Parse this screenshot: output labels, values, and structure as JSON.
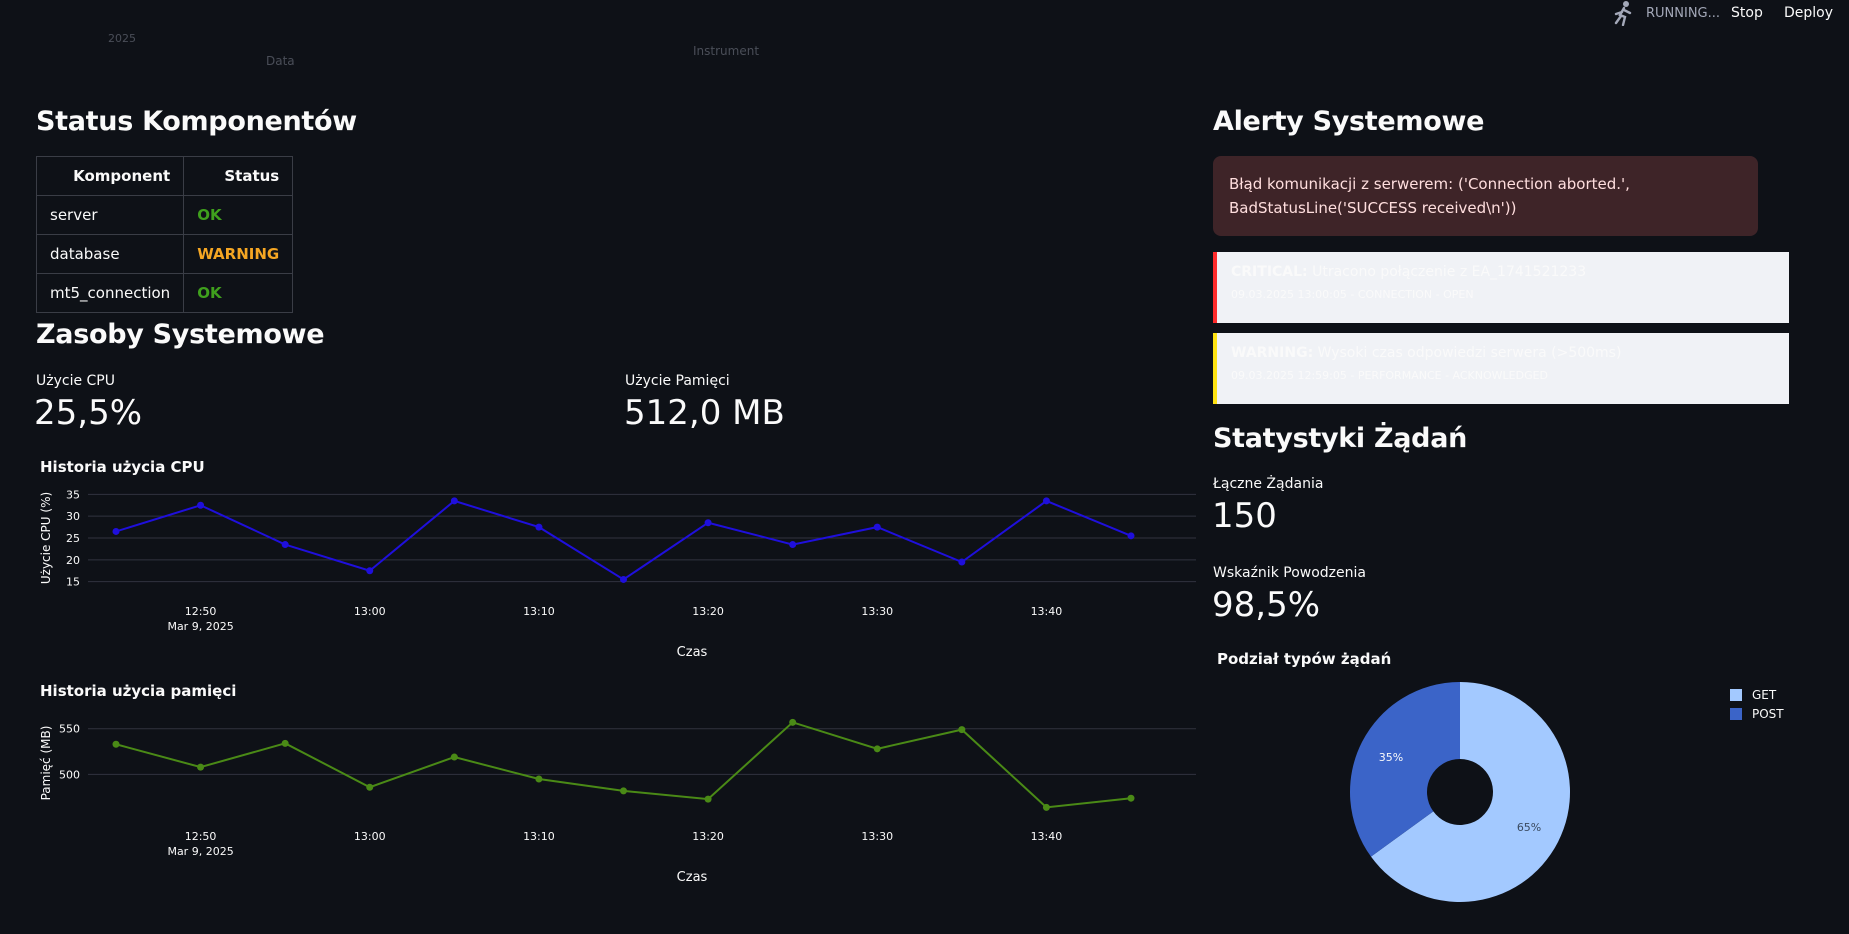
{
  "topbar": {
    "status": "RUNNING...",
    "stop_label": "Stop",
    "deploy_label": "Deploy"
  },
  "ghost": {
    "year": "2025",
    "data": "Data",
    "instrument": "Instrument"
  },
  "components": {
    "title": "Status Komponentów",
    "headers": [
      "Komponent",
      "Status"
    ],
    "rows": [
      {
        "name": "server",
        "status": "OK",
        "color": "#3fa01d"
      },
      {
        "name": "database",
        "status": "WARNING",
        "color": "#f5a623"
      },
      {
        "name": "mt5_connection",
        "status": "OK",
        "color": "#3fa01d"
      }
    ]
  },
  "resources": {
    "title": "Zasoby Systemowe",
    "cpu_label": "Użycie CPU",
    "cpu_value": "25,5%",
    "mem_label": "Użycie Pamięci",
    "mem_value": "512,0 MB"
  },
  "alerts": {
    "title": "Alerty Systemowe",
    "error": "Błąd komunikacji z serwerem: ('Connection aborted.', BadStatusLine('SUCCESS received\\n'))",
    "items": [
      {
        "level": "CRITICAL:",
        "message": "Utracono połączenie z EA_1741521233",
        "meta": "09.03.2025 13:00:05 - CONNECTION - OPEN",
        "color": "#ff2b2b"
      },
      {
        "level": "WARNING:",
        "message": "Wysoki czas odpowiedzi serwera (>500ms)",
        "meta": "09.03.2025 12:59:05 - PERFORMANCE - ACKNOWLEDGED",
        "color": "#ffe312"
      }
    ]
  },
  "requests": {
    "title": "Statystyki Żądań",
    "total_label": "Łączne Żądania",
    "total_value": "150",
    "success_label": "Wskaźnik Powodzenia",
    "success_value": "98,5%"
  },
  "chart_data": [
    {
      "type": "line",
      "title": "Historia użycia CPU",
      "xlabel": "Czas",
      "ylabel": "Użycie CPU (%)",
      "x": [
        "12:45",
        "12:50",
        "12:55",
        "13:00",
        "13:05",
        "13:10",
        "13:15",
        "13:20",
        "13:25",
        "13:30",
        "13:35",
        "13:40",
        "13:45"
      ],
      "xticks": [
        "12:50",
        "13:00",
        "13:10",
        "13:20",
        "13:30",
        "13:40"
      ],
      "xtick_sub": "Mar 9, 2025",
      "ylim": [
        14,
        36
      ],
      "yticks": [
        15,
        20,
        25,
        30,
        35
      ],
      "series": [
        {
          "values": [
            26.5,
            32.5,
            23.5,
            17.5,
            33.5,
            27.5,
            15.5,
            28.5,
            23.5,
            27.5,
            19.5,
            33.5,
            25.5
          ],
          "color": "#1f0fdc"
        }
      ]
    },
    {
      "type": "line",
      "title": "Historia użycia pamięci",
      "xlabel": "Czas",
      "ylabel": "Pamięć (MB)",
      "x": [
        "12:45",
        "12:50",
        "12:55",
        "13:00",
        "13:05",
        "13:10",
        "13:15",
        "13:20",
        "13:25",
        "13:30",
        "13:35",
        "13:40",
        "13:45"
      ],
      "xticks": [
        "12:50",
        "13:00",
        "13:10",
        "13:20",
        "13:30",
        "13:40"
      ],
      "xtick_sub": "Mar 9, 2025",
      "ylim": [
        460,
        565
      ],
      "yticks": [
        500,
        550
      ],
      "series": [
        {
          "values": [
            533,
            508,
            534,
            486,
            519,
            495,
            482,
            473,
            557,
            528,
            549,
            464,
            474
          ],
          "color": "#4a8a16"
        }
      ]
    },
    {
      "type": "pie",
      "title": "Podział typów żądań",
      "categories": [
        "GET",
        "POST"
      ],
      "values": [
        65,
        35
      ],
      "labels": [
        "65%",
        "35%"
      ],
      "colors": [
        "#a3c9ff",
        "#3b64c8"
      ],
      "legend": "top-right"
    }
  ]
}
